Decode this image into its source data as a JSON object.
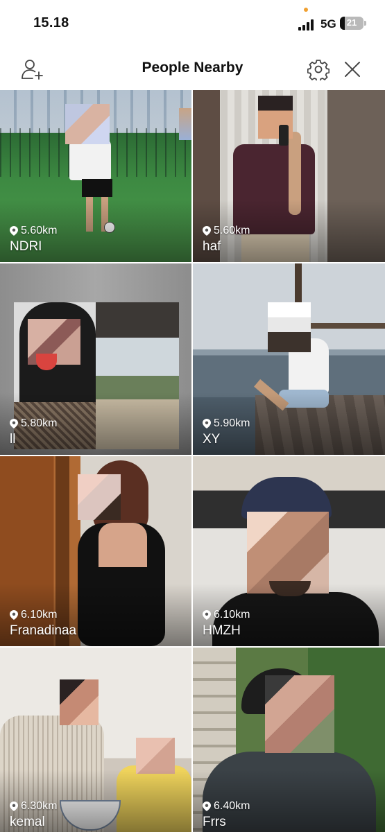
{
  "status": {
    "time": "15.18",
    "network": "5G",
    "battery": "21",
    "battery_level": 0.21
  },
  "header": {
    "title": "People Nearby",
    "add_friend_icon": "person-add-icon",
    "settings_icon": "gear-icon",
    "close_icon": "close-icon"
  },
  "people": [
    {
      "name": "NDRI",
      "distance": "5.60km"
    },
    {
      "name": "haf",
      "distance": "5.60km"
    },
    {
      "name": "ll",
      "distance": "5.80km"
    },
    {
      "name": "XY",
      "distance": "5.90km"
    },
    {
      "name": "Franadinaa",
      "distance": "6.10km"
    },
    {
      "name": "HMZH",
      "distance": "6.10km"
    },
    {
      "name": "kemal",
      "distance": "6.30km"
    },
    {
      "name": "Frrs",
      "distance": "6.40km"
    }
  ],
  "colors": {
    "text": "#111111",
    "icon": "#444444",
    "overlay_text": "#ffffff",
    "background": "#ffffff"
  }
}
